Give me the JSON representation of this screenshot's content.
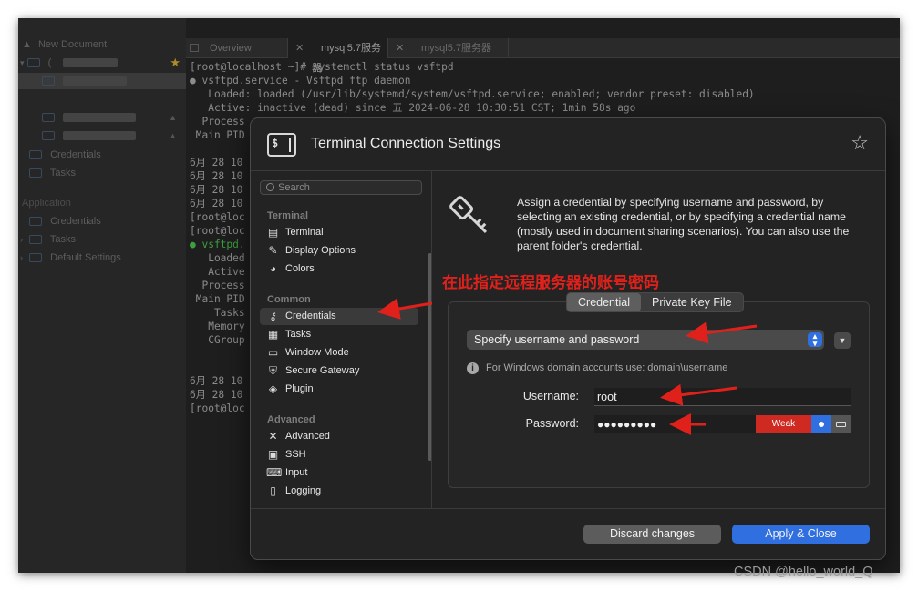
{
  "sidebar": {
    "items": [
      {
        "label": "New Document"
      },
      {
        "label": "("
      },
      {
        "label": "Credentials"
      },
      {
        "label": "Tasks"
      },
      {
        "label": "Credentials"
      },
      {
        "label": "Tasks"
      },
      {
        "label": "Default Settings"
      }
    ],
    "section_application": "Application"
  },
  "tabs": [
    {
      "label": "Overview"
    },
    {
      "label": "mysql5.7服务器"
    },
    {
      "label": "mysql5.7服务器"
    }
  ],
  "terminal": {
    "lines": [
      "[root@localhost ~]# systemctl status vsftpd",
      "● vsftpd.service - Vsftpd ftp daemon",
      "   Loaded: loaded (/usr/lib/systemd/system/vsftpd.service; enabled; vendor preset: disabled)",
      "   Active: inactive (dead) since 五 2024-06-28 10:30:51 CST; 1min 58s ago",
      "  Process",
      " Main PID",
      "",
      "6月 28 10",
      "6月 28 10",
      "6月 28 10",
      "6月 28 10",
      "[root@loc",
      "[root@loc",
      "● vsftpd.",
      "   Loaded",
      "   Active",
      "  Process",
      " Main PID",
      "    Tasks",
      "   Memory",
      "   CGroup",
      "",
      "",
      "6月 28 10",
      "6月 28 10",
      "[root@loc"
    ]
  },
  "dialog": {
    "icon_text": "$",
    "title": "Terminal Connection Settings",
    "search_placeholder": "Search",
    "nav": {
      "terminal_head": "Terminal",
      "terminal_items": [
        "Terminal",
        "Display Options",
        "Colors"
      ],
      "common_head": "Common",
      "common_items": [
        "Credentials",
        "Tasks",
        "Window Mode",
        "Secure Gateway",
        "Plugin"
      ],
      "advanced_head": "Advanced",
      "advanced_items": [
        "Advanced",
        "SSH",
        "Input",
        "Logging"
      ],
      "selected": "Credentials"
    },
    "description": "Assign a credential by specifying username and password, by selecting an existing credential, or by specifying a credential name (mostly used in document sharing scenarios). You can also use the parent folder's credential.",
    "segments": [
      "Credential",
      "Private Key File"
    ],
    "credential_mode": "Specify username and password",
    "hint": "For Windows domain accounts use: domain\\username",
    "username_label": "Username:",
    "username_value": "root",
    "password_label": "Password:",
    "password_mask": "●●●●●●●●●",
    "strength": "Weak",
    "discard_label": "Discard changes",
    "apply_label": "Apply & Close"
  },
  "annotation": "在此指定远程服务器的账号密码",
  "watermark": "CSDN @hello_world_Q",
  "colors": {
    "accent": "#2f6fe0",
    "weak": "#cf2a21",
    "annotation": "#e0211b"
  }
}
